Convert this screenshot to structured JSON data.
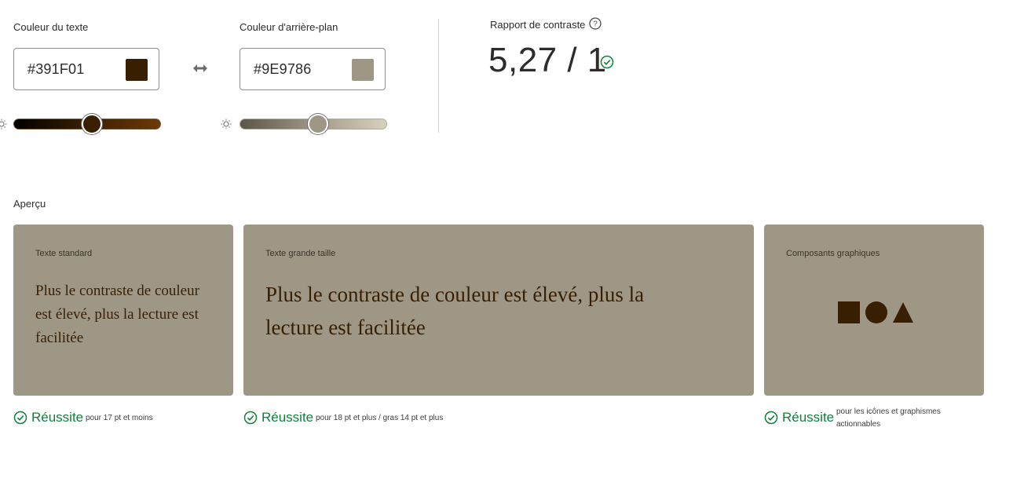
{
  "colors": {
    "text_hex": "#391F01",
    "background_hex": "#9E9786",
    "pass_green": "#12803b"
  },
  "text_color": {
    "label": "Couleur du texte",
    "value": "#391F01",
    "lightness": 0.53
  },
  "background_color": {
    "label": "Couleur d'arrière-plan",
    "value": "#9E9786",
    "lightness": 0.53
  },
  "swap_icon": "swap-arrows-icon",
  "contrast": {
    "label": "Rapport de contraste",
    "help_icon": "question-mark",
    "ratio": "5,27 / 1"
  },
  "preview": {
    "title": "Aperçu",
    "cards": [
      {
        "title": "Texte standard",
        "sample": "Plus le contraste de couleur est élevé, plus la lecture est facilitée",
        "result": "Réussite",
        "note": "pour 17 pt et moins"
      },
      {
        "title": "Texte grande taille",
        "sample": "Plus le contraste de couleur est élevé, plus la lecture est facilitée",
        "result": "Réussite",
        "note": "pour 18 pt et plus / gras 14 pt et plus"
      },
      {
        "title": "Composants graphiques",
        "shapes": [
          "square",
          "circle",
          "triangle"
        ],
        "result": "Réussite",
        "note": "pour les icônes et graphismes actionnables"
      }
    ]
  }
}
